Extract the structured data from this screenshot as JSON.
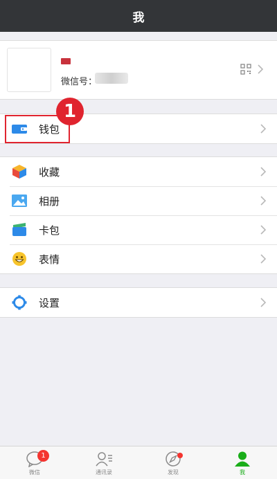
{
  "header": {
    "title": "我"
  },
  "profile": {
    "wxid_label": "微信号："
  },
  "wallet_section": [
    {
      "label": "钱包",
      "icon": "wallet-icon"
    }
  ],
  "menu_section": [
    {
      "label": "收藏",
      "icon": "favorites-cube-icon"
    },
    {
      "label": "相册",
      "icon": "album-icon"
    },
    {
      "label": "卡包",
      "icon": "card-pack-icon"
    },
    {
      "label": "表情",
      "icon": "sticker-smile-icon"
    }
  ],
  "settings_section": [
    {
      "label": "设置",
      "icon": "gear-icon"
    }
  ],
  "annotation": {
    "step_number": "1",
    "color": "#e0242f"
  },
  "tabbar": {
    "tabs": [
      {
        "label": "微信",
        "icon": "chat-bubble-icon",
        "badge": "1"
      },
      {
        "label": "通讯录",
        "icon": "contacts-icon"
      },
      {
        "label": "发现",
        "icon": "compass-icon"
      },
      {
        "label": "我",
        "icon": "person-icon",
        "active": true
      }
    ]
  },
  "colors": {
    "header_bg": "#333538",
    "active_tab": "#1aad19",
    "badge": "#f43530"
  }
}
